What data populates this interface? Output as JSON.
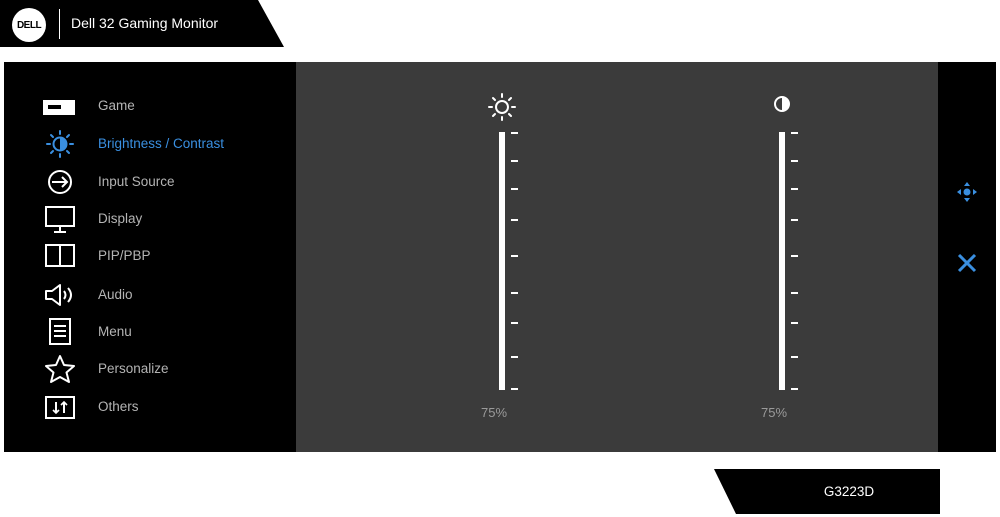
{
  "header": {
    "brand": "DELL",
    "title": "Dell 32 Gaming Monitor"
  },
  "menu": {
    "items": [
      {
        "label": "Game",
        "icon": "game-icon"
      },
      {
        "label": "Brightness / Contrast",
        "icon": "brightness-contrast-icon",
        "active": true
      },
      {
        "label": "Input Source",
        "icon": "input-source-icon"
      },
      {
        "label": "Display",
        "icon": "display-icon"
      },
      {
        "label": "PIP/PBP",
        "icon": "pip-pbp-icon"
      },
      {
        "label": "Audio",
        "icon": "audio-icon"
      },
      {
        "label": "Menu",
        "icon": "menu-icon"
      },
      {
        "label": "Personalize",
        "icon": "star-icon"
      },
      {
        "label": "Others",
        "icon": "others-icon"
      }
    ]
  },
  "sliders": {
    "brightness": {
      "value_label": "75%",
      "value": 75,
      "icon": "sun-icon"
    },
    "contrast": {
      "value_label": "75%",
      "value": 75,
      "icon": "contrast-icon"
    }
  },
  "side": {
    "navigate_icon": "navigate-icon",
    "close_icon": "close-icon"
  },
  "footer": {
    "model": "G3223D"
  },
  "colors": {
    "accent": "#3a8fe0",
    "panel": "#000000",
    "content": "#3b3b3b",
    "text": "#b4b4b4"
  }
}
